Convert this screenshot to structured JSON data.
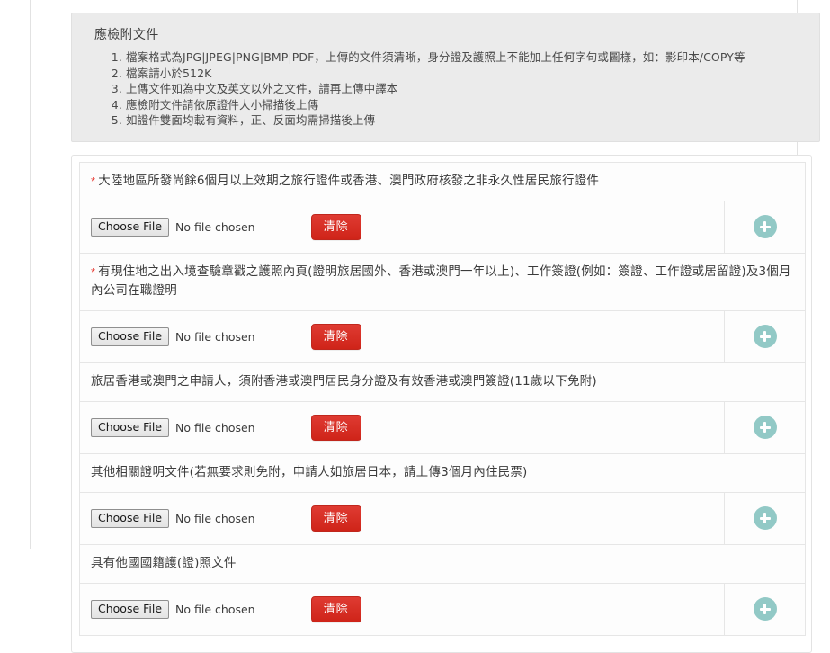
{
  "notice": {
    "title": "應檢附文件",
    "items": [
      "檔案格式為JPG|JPEG|PNG|BMP|PDF，上傳的文件須清晰，身分證及護照上不能加上任何字句或圖樣，如：影印本/COPY等",
      "檔案請小於512K",
      "上傳文件如為中文及英文以外之文件，請再上傳中譯本",
      "應檢附文件請依原證件大小掃描後上傳",
      "如證件雙面均載有資料，正、反面均需掃描後上傳"
    ]
  },
  "upload_controls": {
    "choose_file_label": "Choose File",
    "no_file_label": "No file chosen",
    "clear_label": "清除",
    "add_icon": "plus-icon"
  },
  "documents": [
    {
      "required": true,
      "star": "*",
      "description": "大陸地區所發尚餘6個月以上效期之旅行證件或香港、澳門政府核發之非永久性居民旅行證件"
    },
    {
      "required": true,
      "star": "*",
      "description": "有現住地之出入境查驗章戳之護照內頁(證明旅居國外、香港或澳門一年以上)、工作簽證(例如：簽證、工作證或居留證)及3個月內公司在職證明"
    },
    {
      "required": false,
      "star": "",
      "description": "旅居香港或澳門之申請人，須附香港或澳門居民身分證及有效香港或澳門簽證(11歲以下免附)"
    },
    {
      "required": false,
      "star": "",
      "description": "其他相關證明文件(若無要求則免附，申請人如旅居日本，請上傳3個月內住民票)"
    },
    {
      "required": false,
      "star": "",
      "description": "具有他國國籍護(證)照文件"
    }
  ],
  "colors": {
    "clear_button": "#cf2419",
    "add_button": "#92c9c6",
    "required_star": "#e8413a",
    "notice_background": "#ebebeb"
  }
}
